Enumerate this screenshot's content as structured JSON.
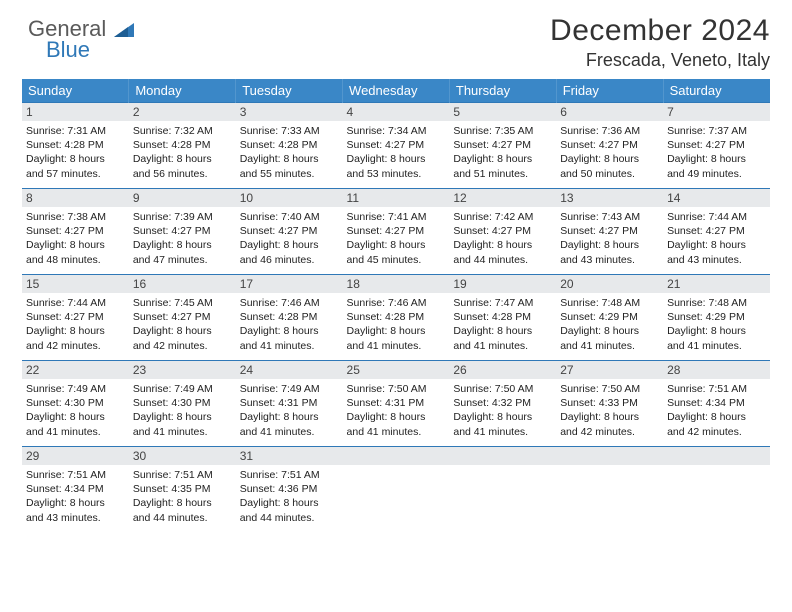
{
  "logo": {
    "line1": "General",
    "line2": "Blue"
  },
  "title": "December 2024",
  "subtitle": "Frescada, Veneto, Italy",
  "weekdays": [
    "Sunday",
    "Monday",
    "Tuesday",
    "Wednesday",
    "Thursday",
    "Friday",
    "Saturday"
  ],
  "weeks": [
    [
      {
        "n": "1",
        "sr": "7:31 AM",
        "ss": "4:28 PM",
        "dl": "8 hours and 57 minutes."
      },
      {
        "n": "2",
        "sr": "7:32 AM",
        "ss": "4:28 PM",
        "dl": "8 hours and 56 minutes."
      },
      {
        "n": "3",
        "sr": "7:33 AM",
        "ss": "4:28 PM",
        "dl": "8 hours and 55 minutes."
      },
      {
        "n": "4",
        "sr": "7:34 AM",
        "ss": "4:27 PM",
        "dl": "8 hours and 53 minutes."
      },
      {
        "n": "5",
        "sr": "7:35 AM",
        "ss": "4:27 PM",
        "dl": "8 hours and 51 minutes."
      },
      {
        "n": "6",
        "sr": "7:36 AM",
        "ss": "4:27 PM",
        "dl": "8 hours and 50 minutes."
      },
      {
        "n": "7",
        "sr": "7:37 AM",
        "ss": "4:27 PM",
        "dl": "8 hours and 49 minutes."
      }
    ],
    [
      {
        "n": "8",
        "sr": "7:38 AM",
        "ss": "4:27 PM",
        "dl": "8 hours and 48 minutes."
      },
      {
        "n": "9",
        "sr": "7:39 AM",
        "ss": "4:27 PM",
        "dl": "8 hours and 47 minutes."
      },
      {
        "n": "10",
        "sr": "7:40 AM",
        "ss": "4:27 PM",
        "dl": "8 hours and 46 minutes."
      },
      {
        "n": "11",
        "sr": "7:41 AM",
        "ss": "4:27 PM",
        "dl": "8 hours and 45 minutes."
      },
      {
        "n": "12",
        "sr": "7:42 AM",
        "ss": "4:27 PM",
        "dl": "8 hours and 44 minutes."
      },
      {
        "n": "13",
        "sr": "7:43 AM",
        "ss": "4:27 PM",
        "dl": "8 hours and 43 minutes."
      },
      {
        "n": "14",
        "sr": "7:44 AM",
        "ss": "4:27 PM",
        "dl": "8 hours and 43 minutes."
      }
    ],
    [
      {
        "n": "15",
        "sr": "7:44 AM",
        "ss": "4:27 PM",
        "dl": "8 hours and 42 minutes."
      },
      {
        "n": "16",
        "sr": "7:45 AM",
        "ss": "4:27 PM",
        "dl": "8 hours and 42 minutes."
      },
      {
        "n": "17",
        "sr": "7:46 AM",
        "ss": "4:28 PM",
        "dl": "8 hours and 41 minutes."
      },
      {
        "n": "18",
        "sr": "7:46 AM",
        "ss": "4:28 PM",
        "dl": "8 hours and 41 minutes."
      },
      {
        "n": "19",
        "sr": "7:47 AM",
        "ss": "4:28 PM",
        "dl": "8 hours and 41 minutes."
      },
      {
        "n": "20",
        "sr": "7:48 AM",
        "ss": "4:29 PM",
        "dl": "8 hours and 41 minutes."
      },
      {
        "n": "21",
        "sr": "7:48 AM",
        "ss": "4:29 PM",
        "dl": "8 hours and 41 minutes."
      }
    ],
    [
      {
        "n": "22",
        "sr": "7:49 AM",
        "ss": "4:30 PM",
        "dl": "8 hours and 41 minutes."
      },
      {
        "n": "23",
        "sr": "7:49 AM",
        "ss": "4:30 PM",
        "dl": "8 hours and 41 minutes."
      },
      {
        "n": "24",
        "sr": "7:49 AM",
        "ss": "4:31 PM",
        "dl": "8 hours and 41 minutes."
      },
      {
        "n": "25",
        "sr": "7:50 AM",
        "ss": "4:31 PM",
        "dl": "8 hours and 41 minutes."
      },
      {
        "n": "26",
        "sr": "7:50 AM",
        "ss": "4:32 PM",
        "dl": "8 hours and 41 minutes."
      },
      {
        "n": "27",
        "sr": "7:50 AM",
        "ss": "4:33 PM",
        "dl": "8 hours and 42 minutes."
      },
      {
        "n": "28",
        "sr": "7:51 AM",
        "ss": "4:34 PM",
        "dl": "8 hours and 42 minutes."
      }
    ],
    [
      {
        "n": "29",
        "sr": "7:51 AM",
        "ss": "4:34 PM",
        "dl": "8 hours and 43 minutes."
      },
      {
        "n": "30",
        "sr": "7:51 AM",
        "ss": "4:35 PM",
        "dl": "8 hours and 44 minutes."
      },
      {
        "n": "31",
        "sr": "7:51 AM",
        "ss": "4:36 PM",
        "dl": "8 hours and 44 minutes."
      },
      null,
      null,
      null,
      null
    ]
  ],
  "labels": {
    "sunrise": "Sunrise:",
    "sunset": "Sunset:",
    "daylight": "Daylight:"
  }
}
